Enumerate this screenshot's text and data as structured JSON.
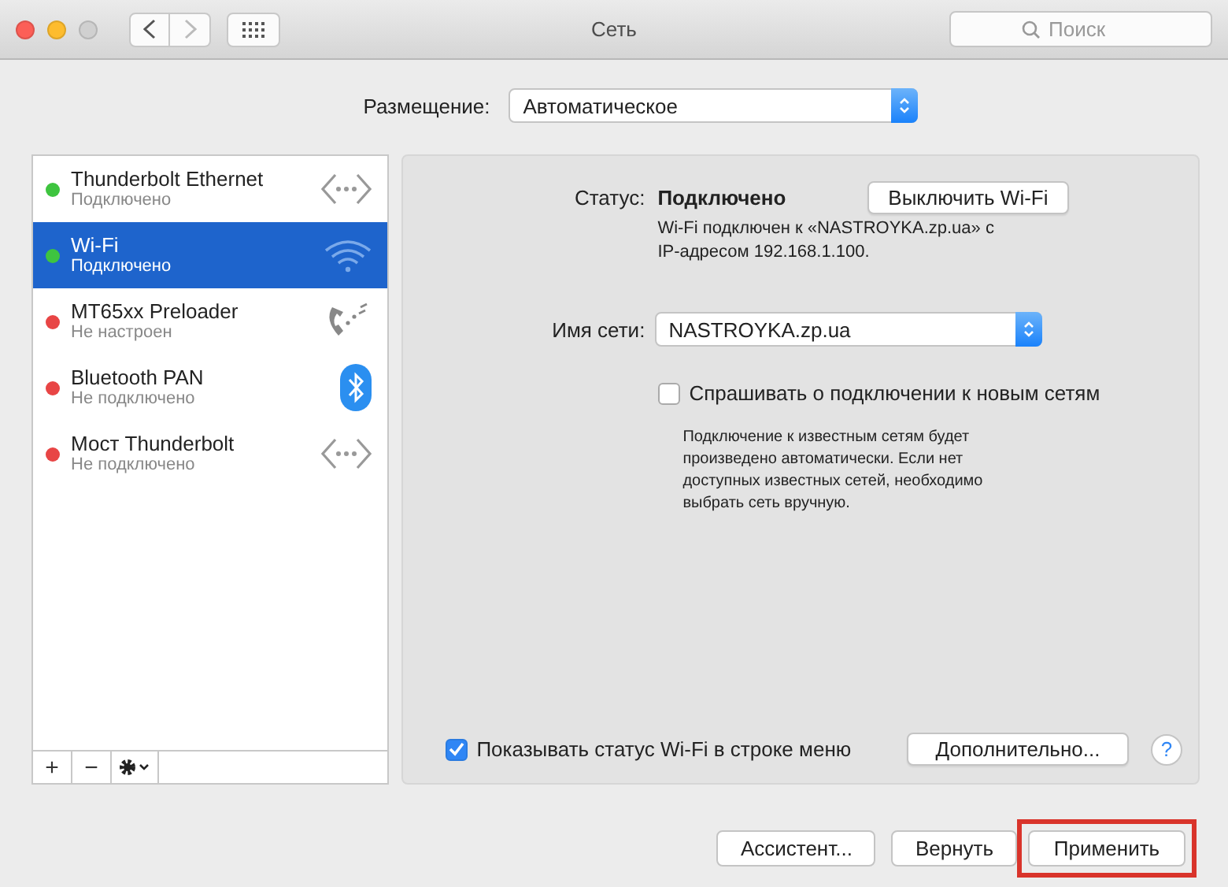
{
  "window": {
    "title": "Сеть",
    "search": {
      "placeholder": "Поиск"
    }
  },
  "location": {
    "label": "Размещение:",
    "value": "Автоматическое"
  },
  "services": [
    {
      "name": "Thunderbolt Ethernet",
      "status": "Подключено",
      "color": "#3ec43f",
      "kind": "ethernet",
      "selected": false
    },
    {
      "name": "Wi-Fi",
      "status": "Подключено",
      "color": "#3ec43f",
      "kind": "wifi",
      "selected": true
    },
    {
      "name": "MT65xx Preloader",
      "status": "Не настроен",
      "color": "#e84545",
      "kind": "modem",
      "selected": false
    },
    {
      "name": "Bluetooth PAN",
      "status": "Не подключено",
      "color": "#e84545",
      "kind": "bluetooth",
      "selected": false
    },
    {
      "name": "Мост Thunderbolt",
      "status": "Не подключено",
      "color": "#e84545",
      "kind": "ethernet",
      "selected": false
    }
  ],
  "list_toolbar": {
    "add": "+",
    "remove": "−"
  },
  "detail": {
    "status_label": "Статус:",
    "status_value": "Подключено",
    "toggle_button": "Выключить Wi-Fi",
    "status_note": "Wi-Fi подключен к «NASTROYKA.zp.ua» с IP-адресом 192.168.1.100.",
    "network_label": "Имя сети:",
    "network_value": "NASTROYKA.zp.ua",
    "ask_checkbox": {
      "label": "Спрашивать о подключении к новым сетям",
      "checked": false
    },
    "ask_note": "Подключение к известным сетям будет произведено автоматически. Если нет доступных известных сетей, необходимо выбрать сеть вручную.",
    "menu_checkbox": {
      "label": "Показывать статус Wi-Fi в строке меню",
      "checked": true
    },
    "advanced_button": "Дополнительно...",
    "help": "?"
  },
  "buttons": [
    {
      "label": "Ассистент...",
      "highlighted": false
    },
    {
      "label": "Вернуть",
      "highlighted": false
    },
    {
      "label": "Применить",
      "highlighted": true
    }
  ]
}
